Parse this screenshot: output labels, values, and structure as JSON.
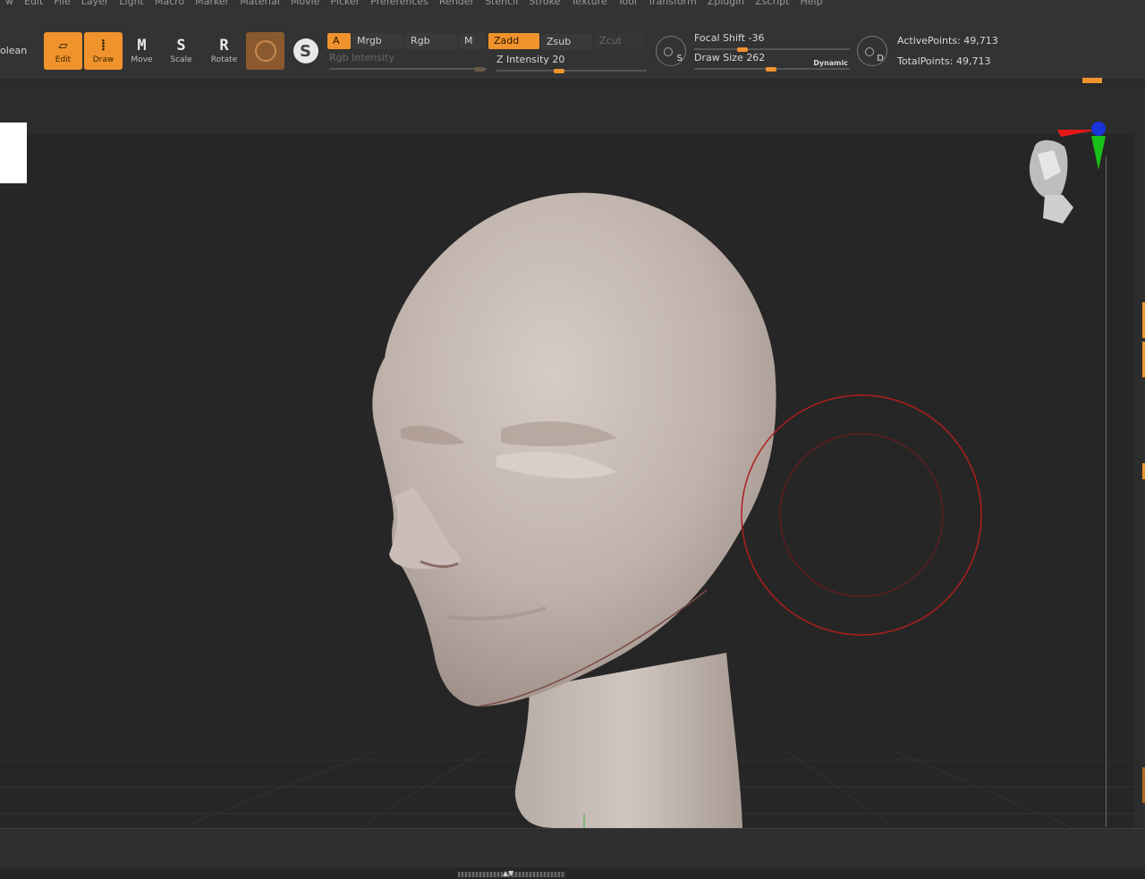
{
  "menu": [
    "w",
    "Edit",
    "File",
    "Layer",
    "Light",
    "Macro",
    "Marker",
    "Material",
    "Movie",
    "Picker",
    "Preferences",
    "Render",
    "Stencil",
    "Stroke",
    "Texture",
    "Tool",
    "Transform",
    "Zplugin",
    "Zscript",
    "Help"
  ],
  "toolbar": {
    "partial_label": "olean",
    "modes": {
      "edit": {
        "glyph": "▱",
        "label": "Edit"
      },
      "draw": {
        "glyph": "⁞",
        "label": "Draw"
      },
      "move": {
        "glyph": "M",
        "label": "Move"
      },
      "scale": {
        "glyph": "S",
        "label": "Scale"
      },
      "rotate": {
        "glyph": "R",
        "label": "Rotate"
      }
    },
    "swatch_a": "A",
    "mrgb": "Mrgb",
    "rgb": "Rgb",
    "m": "M",
    "zadd": "Zadd",
    "zsub": "Zsub",
    "zcut": "Zcut",
    "rgb_intensity_label": "Rgb Intensity",
    "z_intensity_label": "Z Intensity",
    "z_intensity_value": "20",
    "focal_shift_label": "Focal Shift",
    "focal_shift_value": "-36",
    "draw_size_label": "Draw Size",
    "draw_size_value": "262",
    "dynamic_label": "Dynamic",
    "lazy_s": "S",
    "lazy_d": "D",
    "active_points_label": "ActivePoints:",
    "active_points_value": "49,713",
    "total_points_label": "TotalPoints:",
    "total_points_value": "49,713"
  },
  "colors": {
    "accent": "#f0932c",
    "background": "#262626",
    "brush_cursor": "#b01e1e",
    "mesh": "#c9beb8"
  },
  "icons": [
    "edit-icon",
    "draw-icon",
    "move-icon",
    "scale-icon",
    "rotate-icon",
    "material-icon",
    "lazy-mouse-icon",
    "navigation-head-icon",
    "axis-gizmo-icon"
  ]
}
